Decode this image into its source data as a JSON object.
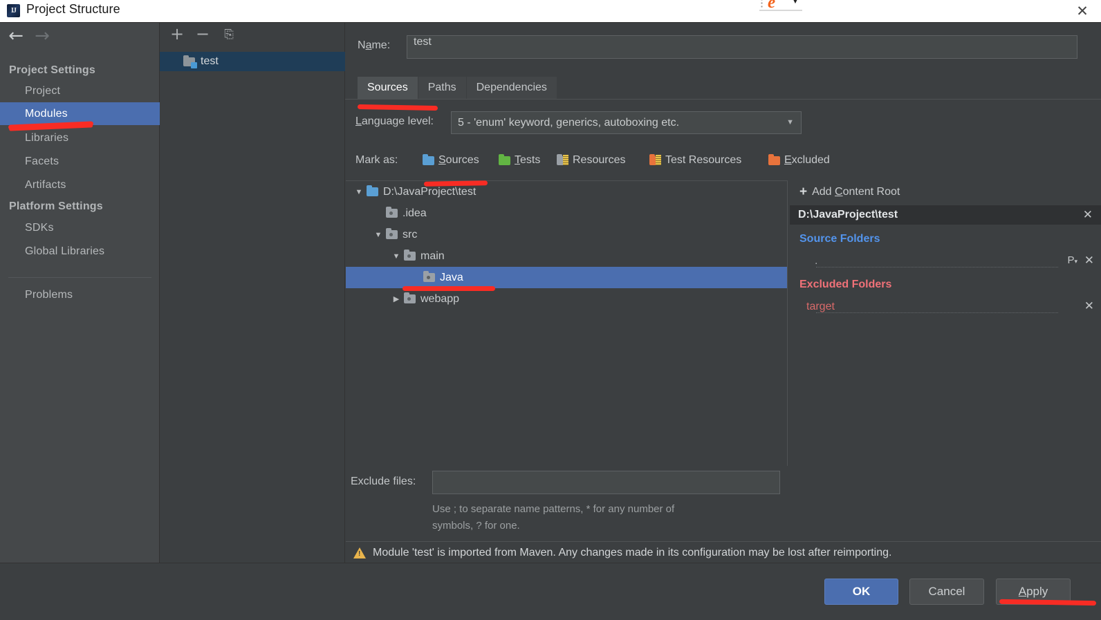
{
  "window": {
    "title": "Project Structure",
    "app_icon": "IJ",
    "close_icon": "✕",
    "fragment": {
      "browser_icon": "e",
      "caret_icon": "▼"
    }
  },
  "nav": {
    "back_icon": "←",
    "forward_icon": "→"
  },
  "sidebar": {
    "groups": [
      {
        "label": "Project Settings"
      },
      {
        "label": "Platform Settings"
      }
    ],
    "items": [
      {
        "label": "Project",
        "selected": false
      },
      {
        "label": "Modules",
        "selected": true
      },
      {
        "label": "Libraries",
        "selected": false
      },
      {
        "label": "Facets",
        "selected": false
      },
      {
        "label": "Artifacts",
        "selected": false
      },
      {
        "label": "SDKs",
        "selected": false
      },
      {
        "label": "Global Libraries",
        "selected": false
      },
      {
        "label": "Problems",
        "selected": false
      }
    ],
    "help_label": "?"
  },
  "modules_panel": {
    "toolbar": {
      "add": "+",
      "remove": "−",
      "copy": "⎘"
    },
    "modules": [
      {
        "name": "test",
        "selected": true
      }
    ]
  },
  "main": {
    "name_field": {
      "label": "Name:",
      "label_pre": "N",
      "label_mnemonic": "a",
      "label_post": "me:",
      "value": "test"
    },
    "tabs": [
      {
        "label": "Sources",
        "active": true
      },
      {
        "label": "Paths",
        "active": false
      },
      {
        "label": "Dependencies",
        "active": false
      }
    ],
    "language_level": {
      "label": "Language level:",
      "label_mnemonic": "L",
      "label_rest": "anguage level:",
      "value": "5 - 'enum' keyword, generics, autoboxing etc.",
      "caret_icon": "▼"
    },
    "mark_as": {
      "label": "Mark as:",
      "options": [
        {
          "label": "Sources",
          "mnemonic": "S",
          "rest": "ources",
          "color": "#5a9fd4",
          "icon": "folder-blue-icon"
        },
        {
          "label": "Tests",
          "mnemonic": "T",
          "rest": "ests",
          "color": "#62b543",
          "icon": "folder-green-icon"
        },
        {
          "label": "Resources",
          "mnemonic": "",
          "rest": "Resources",
          "color": "#9aa0a6",
          "icon": "folder-resources-icon"
        },
        {
          "label": "Test Resources",
          "mnemonic": "",
          "rest": "Test Resources",
          "color": "#e8733c",
          "icon": "folder-test-resources-icon"
        },
        {
          "label": "Excluded",
          "mnemonic": "E",
          "rest": "xcluded",
          "color": "#e8733c",
          "icon": "folder-orange-icon"
        }
      ]
    },
    "tree": [
      {
        "label": "D:\\JavaProject\\test",
        "depth": 0,
        "twisty": "▼",
        "icon": "folder-content-root-icon",
        "selected": false
      },
      {
        "label": ".idea",
        "depth": 1,
        "twisty": "",
        "icon": "folder-plain-icon",
        "selected": false
      },
      {
        "label": "src",
        "depth": 1,
        "twisty": "▼",
        "icon": "folder-plain-icon",
        "selected": false
      },
      {
        "label": "main",
        "depth": 2,
        "twisty": "▼",
        "icon": "folder-plain-icon",
        "selected": false
      },
      {
        "label": "Java",
        "depth": 3,
        "twisty": "",
        "icon": "folder-plain-icon",
        "selected": true
      },
      {
        "label": "webapp",
        "depth": 3,
        "twisty": "▶",
        "icon": "folder-plain-icon",
        "selected": false
      }
    ],
    "exclude_files": {
      "label": "Exclude files:",
      "value": "",
      "hint_line1": "Use ; to separate name patterns, * for any number of",
      "hint_line2": "symbols, ? for one."
    },
    "warning": {
      "icon": "warning-triangle-icon",
      "text": "Module 'test' is imported from Maven. Any changes made in its configuration may be lost after reimporting."
    }
  },
  "roots_panel": {
    "add_content_root": {
      "plus": "+",
      "label": "Add Content Root",
      "pre": "Add ",
      "mnemonic": "C",
      "post": "ontent Root"
    },
    "content_root": {
      "path": "D:\\JavaProject\\test",
      "remove_icon": "✕"
    },
    "source_folders": {
      "title": "Source Folders",
      "entries": [
        {
          "path": ".",
          "package_prefix_icon": "P",
          "caret": "▾",
          "remove_icon": "✕"
        }
      ]
    },
    "excluded_folders": {
      "title": "Excluded Folders",
      "entries": [
        {
          "path": "target",
          "remove_icon": "✕"
        }
      ]
    }
  },
  "buttons": {
    "ok": "OK",
    "cancel": "Cancel",
    "apply": "Apply",
    "apply_mnemonic": "A",
    "apply_rest": "pply"
  },
  "colors": {
    "selection_blue": "#4b6eaf",
    "ok_button": "#4b6eaf",
    "source_folders_label": "#5394ec",
    "excluded_folders_label": "#f07178",
    "annotation_red": "#f82c24",
    "warning_yellow": "#e9b44c",
    "dialog_background": "#3c3f41",
    "sidebar_background": "#45484a"
  }
}
